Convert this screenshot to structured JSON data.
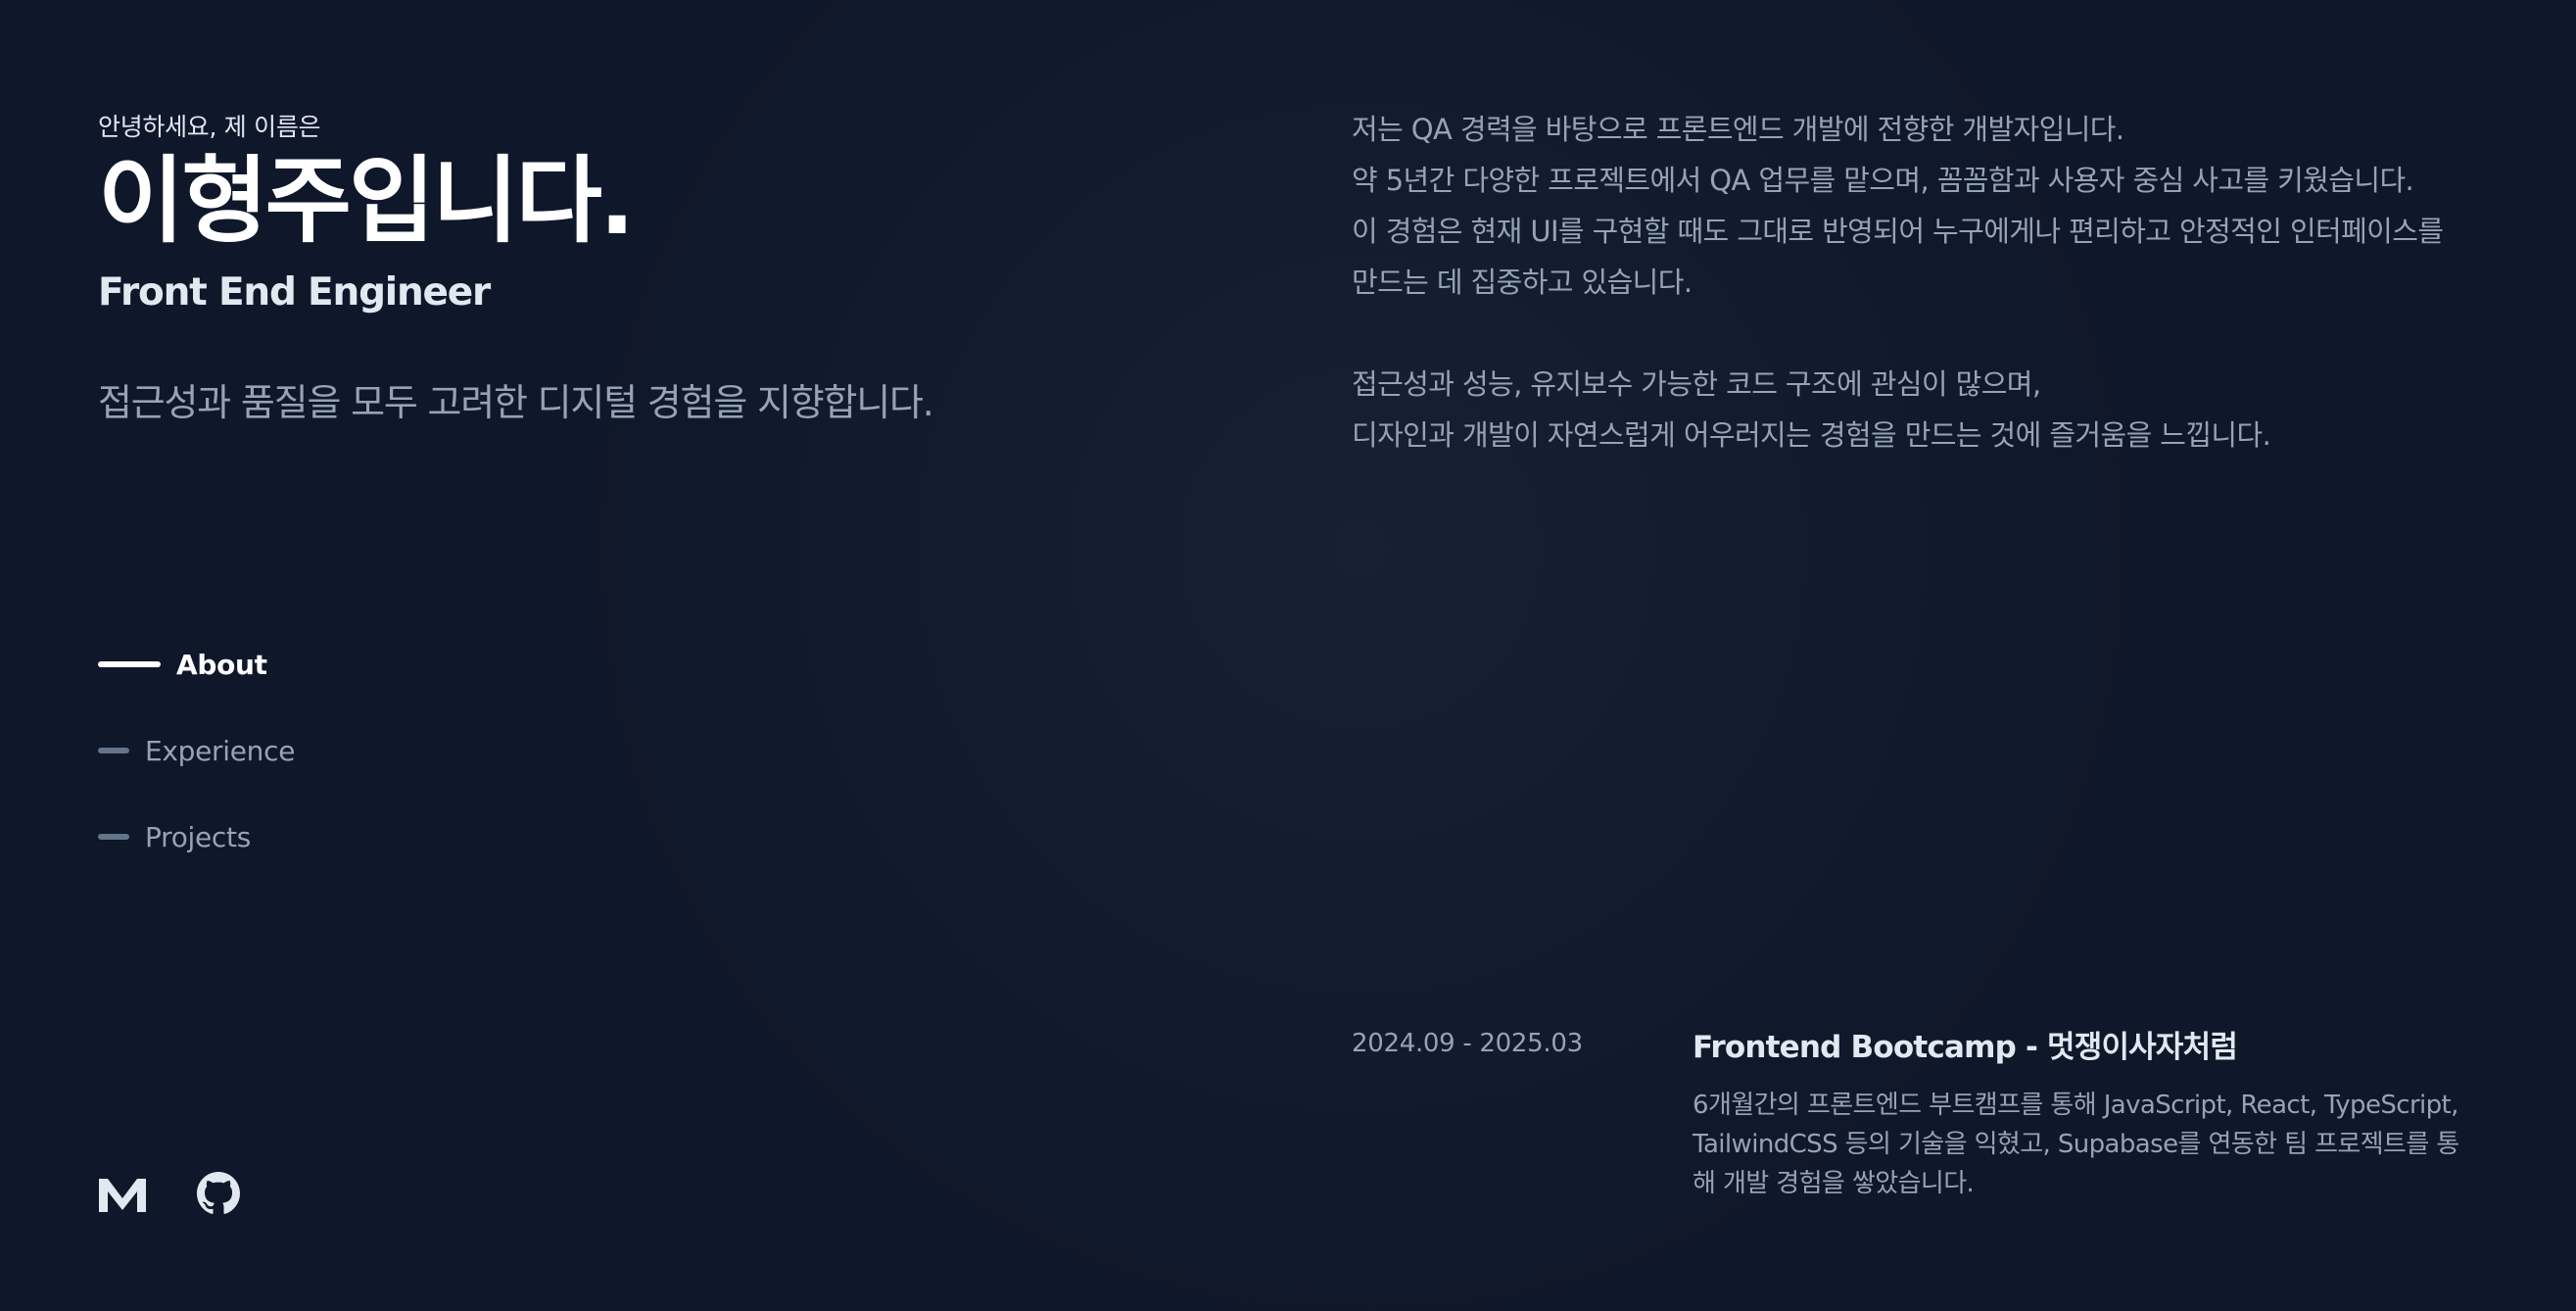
{
  "header": {
    "greeting": "안녕하세요, 제 이름은",
    "name": "이형주입니다.",
    "role": "Front End Engineer",
    "tagline": "접근성과 품질을 모두 고려한 디지털 경험을 지향합니다."
  },
  "nav": {
    "items": [
      {
        "label": "About",
        "active": true
      },
      {
        "label": "Experience",
        "active": false
      },
      {
        "label": "Projects",
        "active": false
      }
    ]
  },
  "socials": [
    {
      "icon": "medium-icon"
    },
    {
      "icon": "github-icon"
    }
  ],
  "about": {
    "paragraph1": [
      "저는 QA 경력을 바탕으로 프론트엔드 개발에 전향한 개발자입니다.",
      "약 5년간 다양한 프로젝트에서 QA 업무를 맡으며, 꼼꼼함과 사용자 중심 사고를 키웠습니다.",
      "이 경험은 현재 UI를 구현할 때도 그대로 반영되어 누구에게나 편리하고 안정적인 인터페이스를",
      "만드는 데 집중하고 있습니다."
    ],
    "paragraph2": [
      "접근성과 성능, 유지보수 가능한 코드 구조에 관심이 많으며,",
      "디자인과 개발이 자연스럽게 어우러지는 경험을 만드는 것에 즐거움을 느낍니다."
    ]
  },
  "experience": [
    {
      "date": "2024.09 - 2025.03",
      "title": "Frontend Bootcamp - 멋쟁이사자처럼",
      "description": [
        "6개월간의 프론트엔드 부트캠프를 통해 JavaScript, React, TypeScript,",
        "TailwindCSS 등의 기술을 익혔고, Supabase를 연동한 팀 프로젝트를 통",
        "해 개발 경험을 쌓았습니다."
      ]
    }
  ],
  "colors": {
    "background": "#0f172a",
    "heading": "#ffffff",
    "subheading": "#e2e8f0",
    "body_text": "#94a3b8",
    "muted_line": "#64748b"
  }
}
